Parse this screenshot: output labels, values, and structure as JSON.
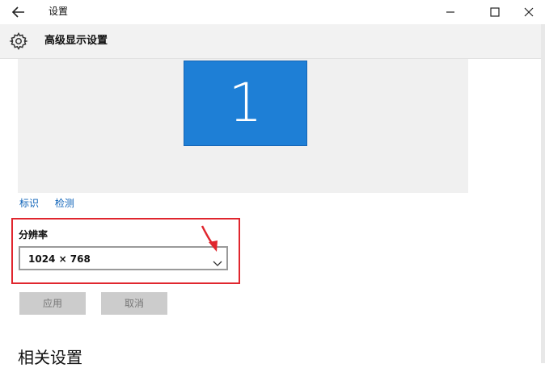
{
  "window": {
    "title": "设置",
    "back_icon": "back-arrow-icon",
    "controls": [
      "minimize-icon",
      "maximize-icon",
      "close-icon"
    ]
  },
  "header": {
    "icon": "gear-icon",
    "title": "高级显示设置"
  },
  "preview": {
    "monitor_number": "1",
    "monitor_color": "#1e7fd6"
  },
  "links": {
    "identify": "标识",
    "detect": "检测"
  },
  "resolution": {
    "label": "分辨率",
    "selected": "1024 × 768",
    "highlight_color": "#e0262e"
  },
  "buttons": {
    "apply": "应用",
    "cancel": "取消"
  },
  "related": {
    "heading": "相关设置"
  }
}
